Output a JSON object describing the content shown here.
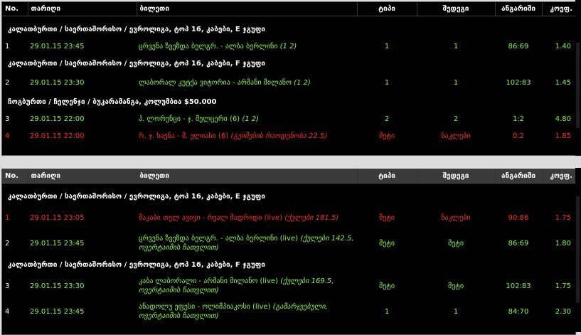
{
  "columns": {
    "no": "No.",
    "date": "თარიღი",
    "ticket": "ბილეთი",
    "type": "ტიპი",
    "result": "შედეგი",
    "score": "ანგარიში",
    "coef": "კოეფ."
  },
  "table1": {
    "groups": [
      {
        "title": "კალათბურთი / საერთაშორისო / ევროლიგა, ტოპ 16, კაბები, E ჯგუფი",
        "rows": [
          {
            "no": "1",
            "date": "29.01.15 23:45",
            "ticket": "ცრვენა ზვეზდა ბელგრ. - ალბა ბერლინი ",
            "note": "(1 2)",
            "type": "1",
            "result": "1",
            "score": "86:69",
            "coef": "1.40",
            "status": "win"
          }
        ]
      },
      {
        "title": "კალათბურთი / საერთაშორისო / ევროლიგა, ტოპ 16, კაბები, F ჯგუფი",
        "rows": [
          {
            "no": "2",
            "date": "29.01.15 23:30",
            "ticket": "ლაბორალ კუტქა ვიტორია - არმანი მილანო ",
            "note": "(1 2)",
            "type": "1",
            "result": "1",
            "score": "102:83",
            "coef": "1.45",
            "status": "win"
          }
        ]
      },
      {
        "title": "ჩოგბურთი / ჩელენჯი / ბუკარამანგა, კოლუმბია $50.000",
        "rows": [
          {
            "no": "3",
            "date": "29.01.15 22:00",
            "ticket": "პ. ლორენცი - ჯ. მელცერი (6) ",
            "note": "(1 2)",
            "type": "2",
            "result": "2",
            "score": "1:2",
            "coef": "4.80",
            "status": "win"
          },
          {
            "no": "4",
            "date": "29.01.15 22:00",
            "ticket": "რ. ჯ. ხაენა - მ. ელიასი (6) ",
            "note": "(გეიმების რაოდენობა 22.5)",
            "type": "მეტი",
            "result": "ნაკლები",
            "score": "0:2",
            "coef": "1.85",
            "status": "lose"
          }
        ]
      }
    ]
  },
  "table2": {
    "groups": [
      {
        "title": "კალათბურთი / საერთაშორისო / ევროლიგა, ტოპ 16, კაბები, E ჯგუფი",
        "rows": [
          {
            "no": "1",
            "date": "29.01.15 23:05",
            "ticket": "მაკაბი თელ ავივი - რეალ მადრიდი (live) ",
            "note": "(ქულები 181.5)",
            "type": "მეტი",
            "result": "ნაკლები",
            "score": "90:86",
            "coef": "1.75",
            "status": "lose"
          },
          {
            "no": "2",
            "date": "29.01.15 23:45",
            "ticket": "ცრვენა ზვეზდა ბელგრ. - ალბა ბერლინი (live) ",
            "note": "(ქულები 142.5, ოვერტაიმის ჩათვლით)",
            "type": "მეტი",
            "result": "მეტი",
            "score": "86:69",
            "coef": "1.80",
            "status": "win"
          }
        ]
      },
      {
        "title": "კალათბურთი / საერთაშორისო / ევროლიგა, ტოპ 16, კაბები, F ჯგუფი",
        "rows": [
          {
            "no": "3",
            "date": "29.01.15 23:30",
            "ticket": "კაბა ლაბორალი - არმანი მილანო (live) ",
            "note": "(ქულები 169.5, ოვერტაიმის ჩათვლით)",
            "type": "მეტი",
            "result": "მეტი",
            "score": "102:83",
            "coef": "1.75",
            "status": "win"
          },
          {
            "no": "4",
            "date": "29.01.15 23:45",
            "ticket": "ანადოლუ ეფესი - ოლიმპიაკოსი (live) ",
            "note": "(გამარჯვებული, ოვერტაიმის ჩათვლით)",
            "type": "1",
            "result": "1",
            "score": "84:70",
            "coef": "2.30",
            "status": "win"
          }
        ]
      }
    ]
  }
}
